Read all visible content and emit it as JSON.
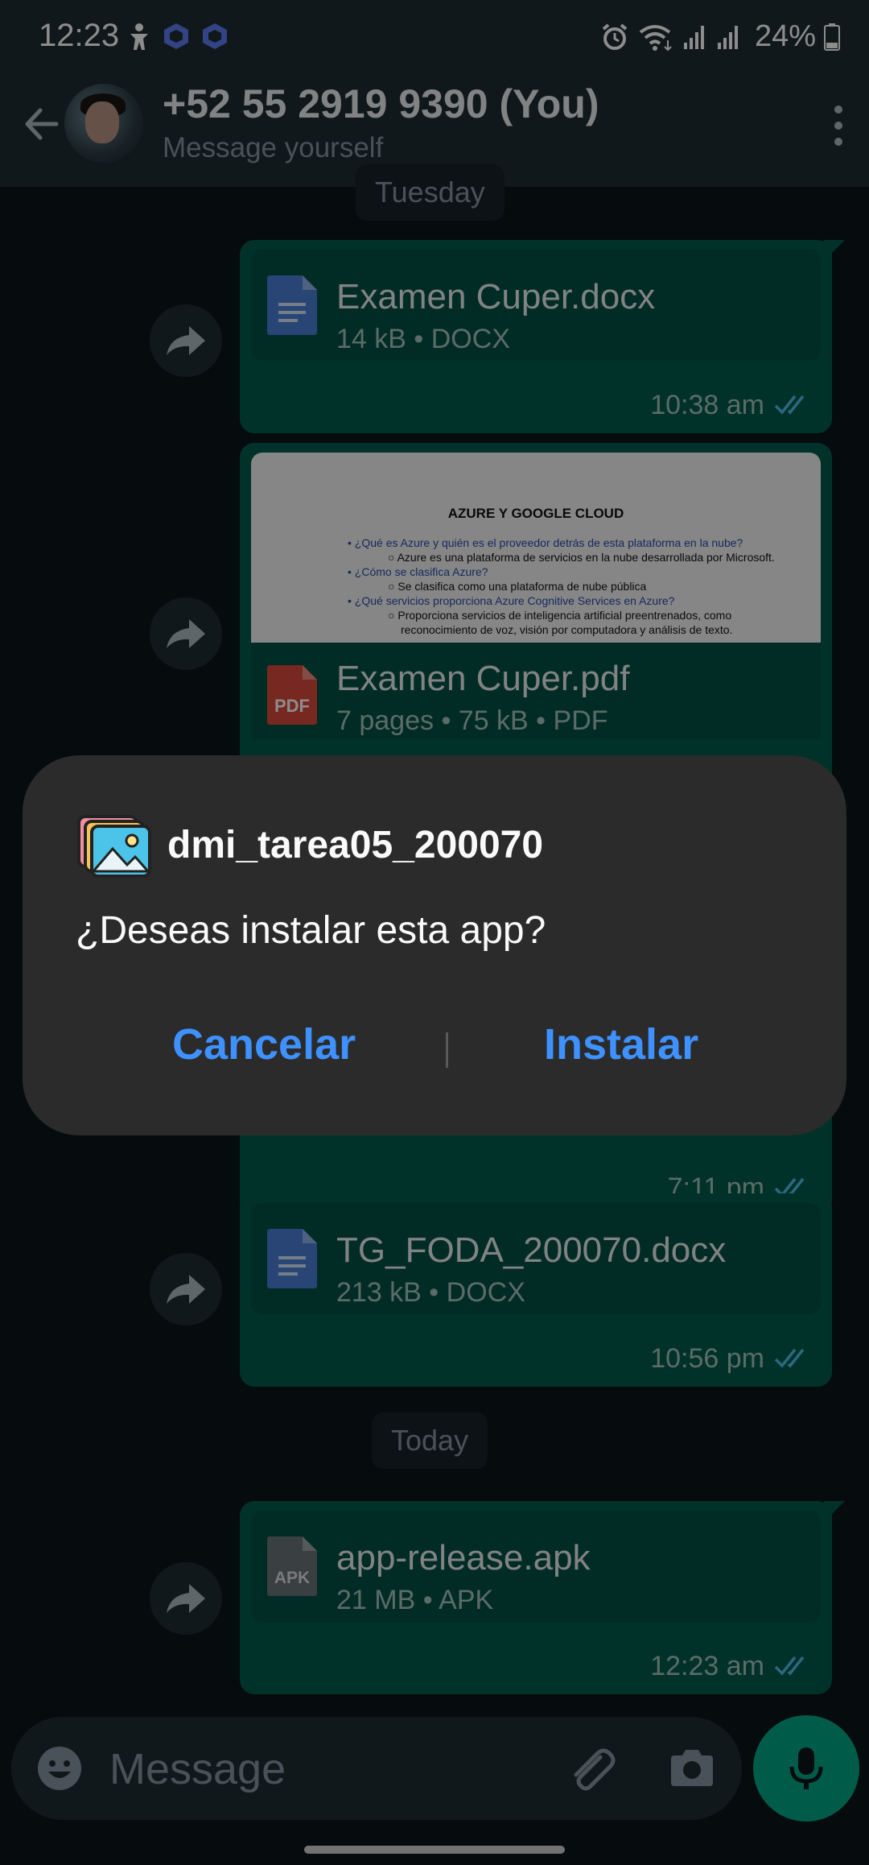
{
  "status_bar": {
    "time": "12:23",
    "battery_percent": "24%",
    "icons": [
      "accessibility-icon",
      "app-icon",
      "app-icon",
      "alarm-icon",
      "wifi-icon",
      "signal-icon",
      "signal-icon",
      "battery-icon"
    ]
  },
  "header": {
    "title": "+52 55 2919 9390 (You)",
    "subtitle": "Message yourself"
  },
  "chat": {
    "date_tuesday": "Tuesday",
    "date_today": "Today",
    "messages": [
      {
        "name": "Examen Cuper.docx",
        "meta": "14 kB • DOCX",
        "time": "10:38 am",
        "icon": "docx-icon"
      },
      {
        "name": "Examen Cuper.pdf",
        "meta": "7 pages • 75 kB • PDF",
        "time": "7:11 pm",
        "icon": "pdf-icon",
        "icon_label": "PDF"
      },
      {
        "name": "TG_FODA_200070.docx",
        "meta": "213 kB • DOCX",
        "time": "10:56 pm",
        "icon": "docx-icon"
      },
      {
        "name": "app-release.apk",
        "meta": "21 MB • APK",
        "time": "12:23 am",
        "icon": "apk-icon",
        "icon_label": "APK"
      }
    ],
    "pdf_preview": {
      "title": "AZURE Y GOOGLE CLOUD",
      "lines": [
        "¿Qué es Azure y quién es el proveedor detrás de esta plataforma en la nube?",
        "Azure es una plataforma de servicios en la nube desarrollada por Microsoft.",
        "¿Cómo se clasifica Azure?",
        "Se clasifica como una plataforma de nube pública",
        "¿Qué servicios proporciona Azure Cognitive Services en Azure?",
        "Proporciona servicios de inteligencia artificial preentrenados, como",
        "reconocimiento de voz, visión por computadora y análisis de texto."
      ]
    }
  },
  "input": {
    "placeholder": "Message"
  },
  "dialog": {
    "app_name": "dmi_tarea05_200070",
    "question": "¿Deseas instalar esta app?",
    "cancel_label": "Cancelar",
    "install_label": "Instalar"
  },
  "colors": {
    "accent_blue": "#3e91ff",
    "bubble_green": "#005c4b",
    "mic_green": "#00a884",
    "tick_blue": "#53bdeb"
  }
}
